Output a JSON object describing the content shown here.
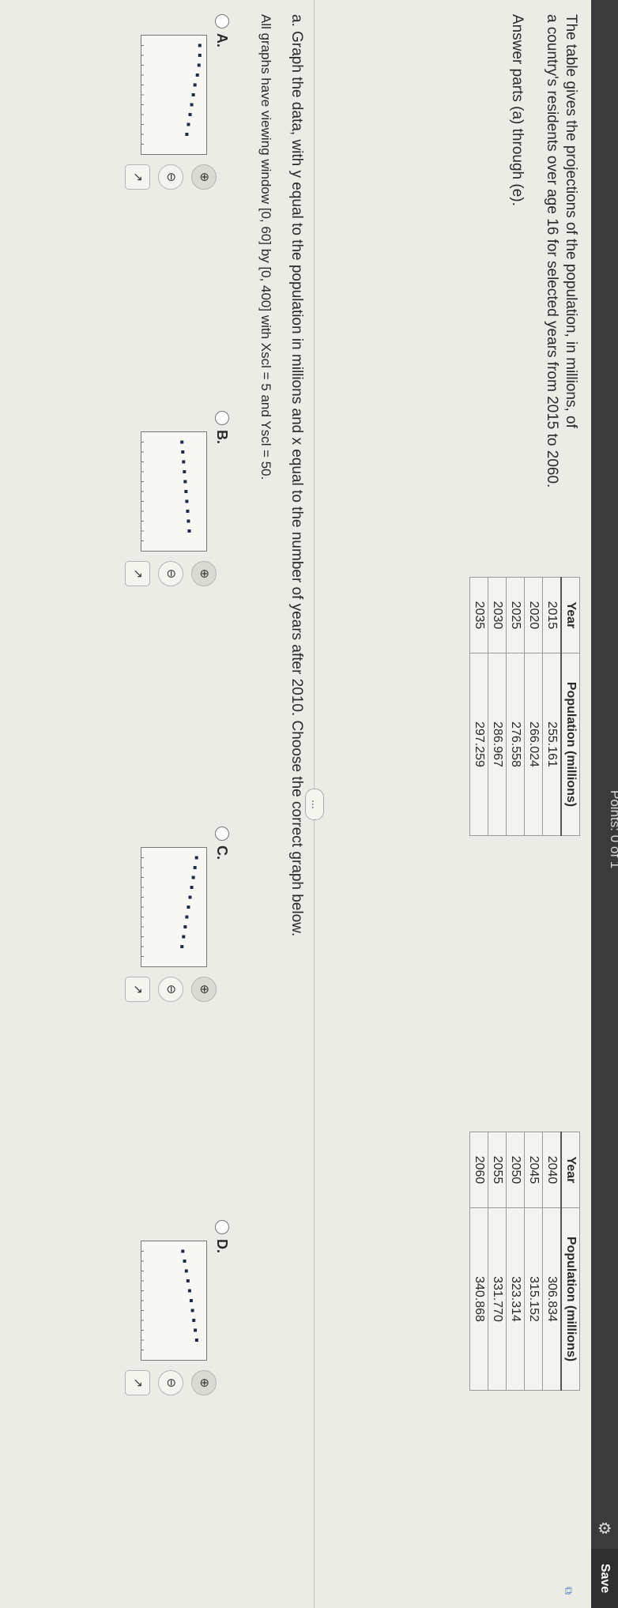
{
  "header": {
    "points": "Points: 0 of 1",
    "save_label": "Save"
  },
  "question": {
    "intro_line1": "The table gives the projections of the population, in millions, of",
    "intro_line2": "a country's residents over age 16 for selected years from 2015 to 2060.",
    "intro_line3": "Answer parts (a) through (e).",
    "part_a": "a. Graph the data, with y equal to the population in millions and x equal to the number of years after 2010. Choose the correct graph below.",
    "window_note": "All graphs have viewing window [0, 60] by [0, 400] with Xscl = 5 and Yscl = 50."
  },
  "table": {
    "col_year": "Year",
    "col_pop": "Population (millions)",
    "left": [
      {
        "year": "2015",
        "pop": "255.161"
      },
      {
        "year": "2020",
        "pop": "266.024"
      },
      {
        "year": "2025",
        "pop": "276.558"
      },
      {
        "year": "2030",
        "pop": "286.967"
      },
      {
        "year": "2035",
        "pop": "297.259"
      }
    ],
    "right": [
      {
        "year": "2040",
        "pop": "306.834"
      },
      {
        "year": "2045",
        "pop": "315.152"
      },
      {
        "year": "2050",
        "pop": "323.314"
      },
      {
        "year": "2055",
        "pop": "331.770"
      },
      {
        "year": "2060",
        "pop": "340.868"
      }
    ]
  },
  "more_label": "...",
  "options": [
    {
      "label": "A."
    },
    {
      "label": "B."
    },
    {
      "label": "C."
    },
    {
      "label": "D."
    }
  ],
  "chart_data": [
    {
      "type": "scatter",
      "x": [
        5,
        10,
        15,
        20,
        25,
        30,
        35,
        40,
        45,
        50
      ],
      "y": [
        360,
        360,
        355,
        345,
        330,
        320,
        310,
        300,
        290,
        280
      ],
      "xlim": [
        0,
        60
      ],
      "ylim": [
        0,
        400
      ]
    },
    {
      "type": "scatter",
      "x": [
        5,
        10,
        15,
        20,
        25,
        30,
        35,
        40,
        45,
        50
      ],
      "y": [
        250,
        255,
        260,
        265,
        270,
        275,
        280,
        285,
        290,
        295
      ],
      "xlim": [
        0,
        60
      ],
      "ylim": [
        0,
        400
      ]
    },
    {
      "type": "scatter",
      "x": [
        5,
        10,
        15,
        20,
        25,
        30,
        35,
        40,
        45,
        50
      ],
      "y": [
        340,
        330,
        320,
        310,
        300,
        290,
        280,
        270,
        260,
        250
      ],
      "xlim": [
        0,
        60
      ],
      "ylim": [
        0,
        400
      ]
    },
    {
      "type": "scatter",
      "x": [
        5,
        10,
        15,
        20,
        25,
        30,
        35,
        40,
        45,
        50
      ],
      "y": [
        255,
        266,
        277,
        287,
        297,
        307,
        315,
        323,
        332,
        341
      ],
      "xlim": [
        0,
        60
      ],
      "ylim": [
        0,
        400
      ]
    }
  ]
}
